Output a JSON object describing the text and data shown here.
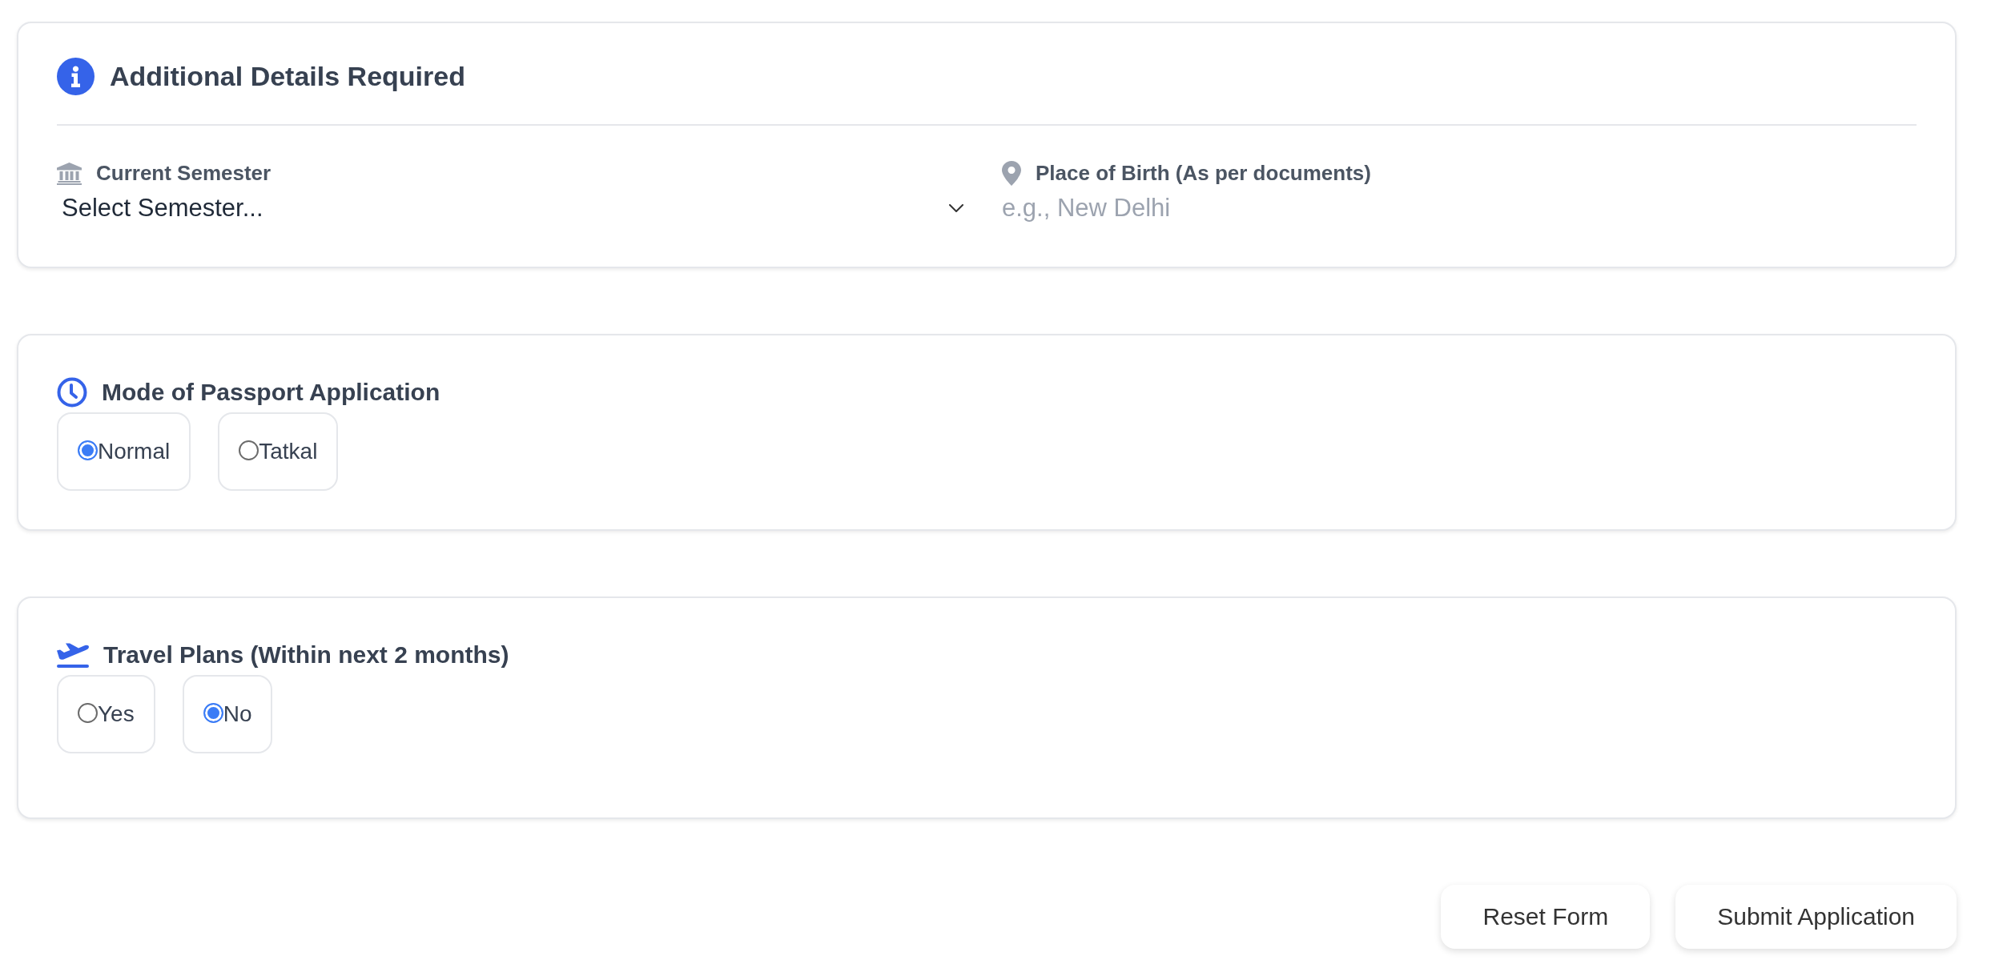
{
  "details_card": {
    "title": "Additional Details Required",
    "fields": [
      {
        "kind": "select",
        "label": "Current Semester",
        "value": "Select Semester..."
      },
      {
        "kind": "text",
        "label": "Place of Birth (As per documents)",
        "placeholder": "e.g., New Delhi"
      }
    ]
  },
  "sections": [
    {
      "title": "Mode of Passport Application",
      "options": [
        {
          "label": "Normal",
          "selected": true
        },
        {
          "label": "Tatkal",
          "selected": false
        }
      ]
    },
    {
      "title": "Travel Plans (Within next 2 months)",
      "options": [
        {
          "label": "Yes",
          "selected": false
        },
        {
          "label": "No",
          "selected": true
        }
      ]
    }
  ],
  "buttons": [
    "Reset Form",
    "Submit Application"
  ]
}
